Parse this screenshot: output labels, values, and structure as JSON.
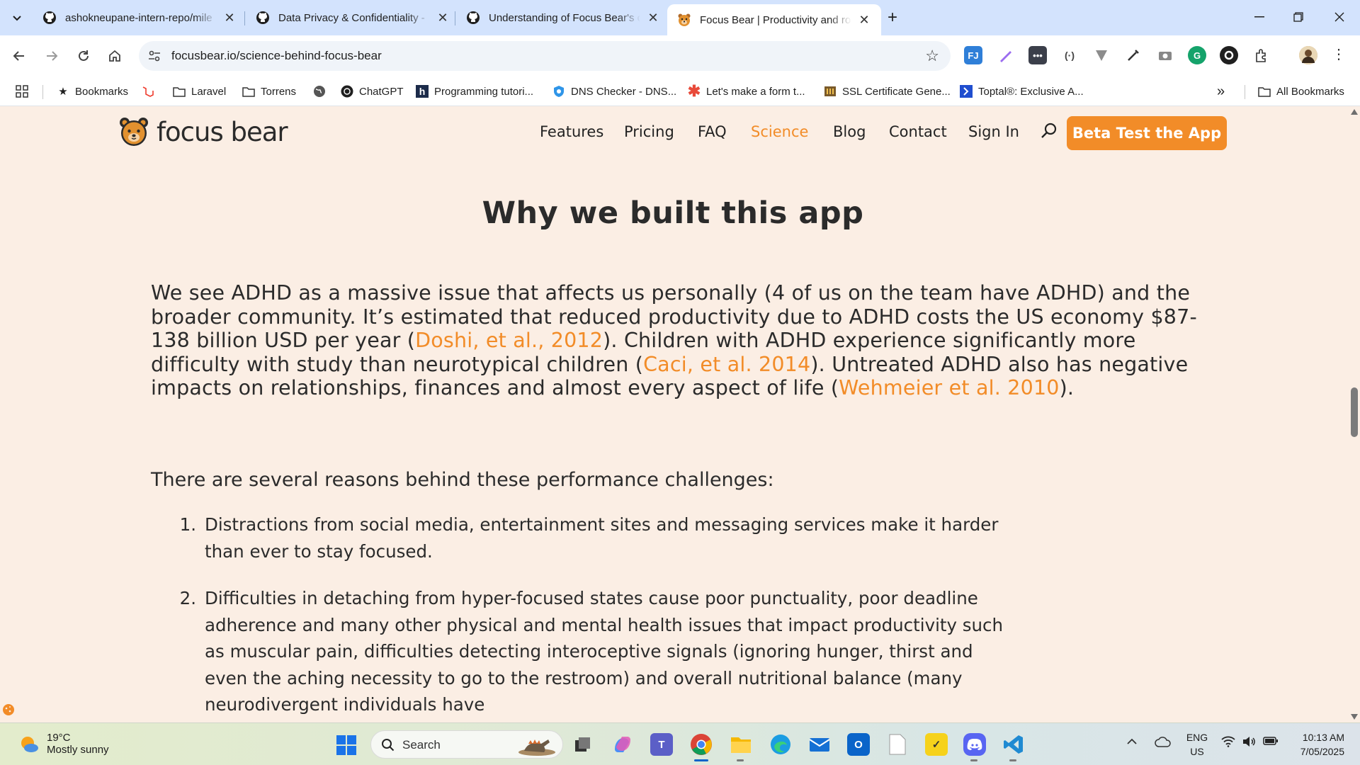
{
  "browser": {
    "tabs": [
      {
        "title": "ashokneupane-intern-repo/mile",
        "favicon": "github-icon",
        "active": false
      },
      {
        "title": "Data Privacy & Confidentiality -",
        "favicon": "github-icon",
        "active": false
      },
      {
        "title": "Understanding of Focus Bear's c",
        "favicon": "github-icon",
        "active": false
      },
      {
        "title": "Focus Bear | Productivity and ro",
        "favicon": "focus-bear-icon",
        "active": true
      }
    ],
    "url": "focusbear.io/science-behind-focus-bear",
    "bookmarks": [
      {
        "label": "Bookmarks",
        "icon": "star-icon"
      },
      {
        "label": "",
        "icon": "laravel-icon"
      },
      {
        "label": "Laravel",
        "icon": "folder-icon"
      },
      {
        "label": "Torrens",
        "icon": "folder-icon"
      },
      {
        "label": "",
        "icon": "globe-icon"
      },
      {
        "label": "ChatGPT",
        "icon": "chatgpt-icon"
      },
      {
        "label": "Programming tutori...",
        "icon": "h-icon"
      },
      {
        "label": "DNS Checker - DNS...",
        "icon": "dns-icon"
      },
      {
        "label": "Let's make a form t...",
        "icon": "asterisk-icon"
      },
      {
        "label": "SSL Certificate Gene...",
        "icon": "ssl-icon"
      },
      {
        "label": "Toptal®: Exclusive A...",
        "icon": "toptal-icon"
      }
    ],
    "all_bookmarks": "All Bookmarks",
    "overflow": "»"
  },
  "site": {
    "logo_text": "focus bear",
    "nav": [
      "Features",
      "Pricing",
      "FAQ",
      "Science",
      "Blog",
      "Contact",
      "Sign In"
    ],
    "active_nav": "Science",
    "cta": "Beta Test the App"
  },
  "article": {
    "title": "Why we built this app",
    "intro": [
      {
        "t": "We see ADHD as a massive issue that affects us personally (4 of us on the team have ADHD) and the broader community. It’s estimated that reduced productivity due to ADHD costs the US economy $87-138 billion USD per year (",
        "link": false
      },
      {
        "t": "Doshi, et al., 2012",
        "link": true
      },
      {
        "t": "). Children with ADHD experience significantly more difficulty with study than neurotypical children (",
        "link": false
      },
      {
        "t": "Caci, et al. 2014",
        "link": true
      },
      {
        "t": "). Untreated ADHD also has negative impacts on relationships, finances and almost every aspect of life (",
        "link": false
      },
      {
        "t": "Wehmeier et al. 2010",
        "link": true
      },
      {
        "t": ").",
        "link": false
      }
    ],
    "reasons_heading": "There are several reasons behind these performance challenges:",
    "reasons": [
      {
        "num": "1.",
        "text": "Distractions from social media, entertainment sites and messaging services make it harder than ever to stay focused."
      },
      {
        "num": "2.",
        "text": "Difficulties in detaching from hyper-focused states cause poor punctuality, poor deadline adherence and many other physical and mental health issues that impact productivity such as muscular pain, difficulties detecting interoceptive signals (ignoring hunger, thirst and even the aching necessity to go to the restroom) and overall nutritional balance (many neurodivergent individuals have"
      }
    ]
  },
  "taskbar": {
    "weather_temp": "19°C",
    "weather_desc": "Mostly sunny",
    "search_label": "Search",
    "lang_1": "ENG",
    "lang_2": "US",
    "time": "10:13 AM",
    "date": "7/05/2025"
  },
  "colors": {
    "accent": "#f28c28",
    "page_bg": "#fbeee4",
    "text": "#2b2b2b",
    "tabstrip": "#d3e3fd"
  }
}
